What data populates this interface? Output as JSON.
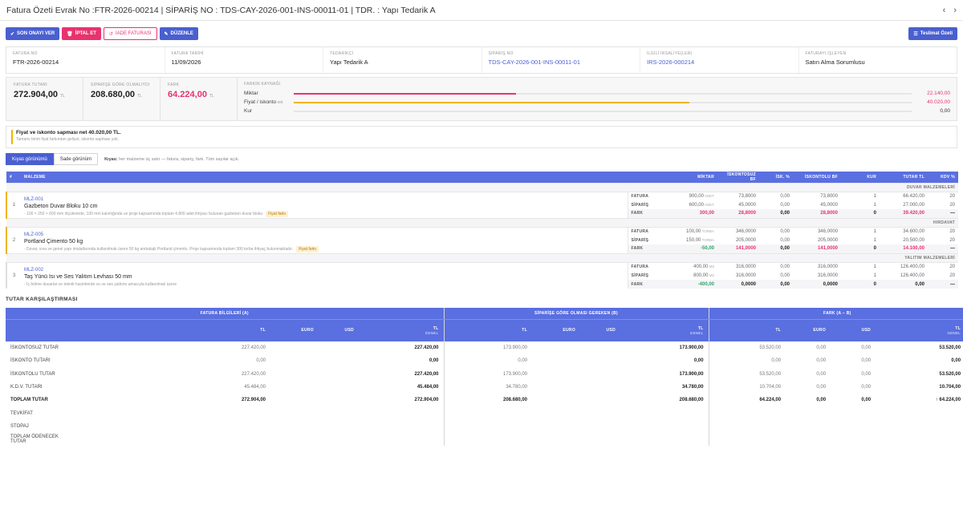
{
  "title": "Fatura Özeti Evrak No :FTR-2026-00214 | SİPARİŞ NO : TDS-CAY-2026-001-INS-00011-01 | TDR. : Yapı Tedarik A",
  "nav": {
    "prev": "‹",
    "next": "›"
  },
  "toolbar": {
    "approve": "SON ONAYI VER",
    "cancel": "İPTAL ET",
    "return_invoice": "İADE FATURASI",
    "edit": "DÜZENLE",
    "delivery_summary": "Teslimat Özeti"
  },
  "info": [
    {
      "label": "FATURA NO",
      "value": "FTR-2026-00214"
    },
    {
      "label": "FATURA TARİHİ",
      "value": "11/09/2026"
    },
    {
      "label": "TEDARİKÇİ",
      "value": "Yapı Tedarik A"
    },
    {
      "label": "SİPARİŞ NO",
      "value": "TDS-CAY-2026-001-INS-00011-01"
    },
    {
      "label": "İLGİLİ İRSALİYE(LER)",
      "value": "IRS-2026-000214"
    },
    {
      "label": "FATURAYI İŞLEYEN",
      "value": "Satın Alma Sorumlusu"
    }
  ],
  "summary": {
    "invoice_total": {
      "label": "FATURA TUTARI",
      "value": "272.904,00",
      "unit": "TL"
    },
    "order_total": {
      "label": "SİPARİŞE GÖRE OLMALIYDI",
      "value": "208.680,00",
      "unit": "TL"
    },
    "diff": {
      "label": "FARK",
      "value": "64.224,00",
      "unit": "TL"
    },
    "source_label": "FARKIN KAYNAĞI",
    "sources": [
      {
        "name": "Miktar",
        "note": "",
        "amount": "22.140,00",
        "ratio": 0.36,
        "color": "#e8336e"
      },
      {
        "name": "Fiyat / iskonto",
        "note": "net",
        "amount": "40.020,00",
        "ratio": 0.64,
        "color": "#f0b400"
      },
      {
        "name": "Kur",
        "note": "",
        "amount": "0,00",
        "ratio": 0,
        "color": "#cccccc"
      }
    ]
  },
  "alert": {
    "title": "Fiyat ve iskonto sapması net 40.020,00 TL.",
    "sub": "Tamamı birim fiyat farkından geliyor, iskonto sapması yok."
  },
  "views": {
    "compare": "Kıyas görünümü",
    "simple": "Sade görünüm",
    "hint_label": "Kıyas:",
    "hint": "her malzeme üç satır — fatura, sipariş, fark. Tüm sayılar açık."
  },
  "material_headers": [
    "#",
    "MALZEME",
    "",
    "MİKTAR",
    "İSKONTOSUZ BF",
    "İSK. %",
    "İSKONTOLU BF",
    "KUR",
    "TUTAR TL",
    "KDV %"
  ],
  "materials": [
    {
      "group": "DUVAR MALZEMELERİ",
      "idx": "1",
      "code": "MLZ-001",
      "name": "Gazbeton Duvar Bloku 10 cm",
      "desc": "· 100 × 250 × 600 mm ölçülerinde, 100 mm kalınlığında ve proje kapsamında toplam 4.800 adet ihtiyacı bulunan gazbeton duvar bloku",
      "tag": "Fiyat farkı",
      "rows": [
        {
          "label": "FATURA",
          "qty": "900,00",
          "unit": "ADET",
          "gross": "73,8000",
          "disc": "0,00",
          "net": "73,8000",
          "rate": "1",
          "total": "66.420,00",
          "vat": "20"
        },
        {
          "label": "SİPARİŞ",
          "qty": "600,00",
          "unit": "ADET",
          "gross": "45,0000",
          "disc": "0,00",
          "net": "45,0000",
          "rate": "1",
          "total": "27.000,00",
          "vat": "20"
        },
        {
          "label": "FARK",
          "qty": "300,00",
          "unit": "",
          "gross": "28,8000",
          "disc": "0,00",
          "net": "28,8000",
          "rate": "0",
          "total": "39.420,00",
          "vat": "—"
        }
      ]
    },
    {
      "group": "HIRDAVAT",
      "idx": "2",
      "code": "MLZ-005",
      "name": "Portland Çimento 50 kg",
      "desc": "· Duvar, sıva ve genel yapı imalatlarında kullanılmak üzere 50 kg ambalajlı Portland çimento. Proje kapsamında toplam 300 torba ihtiyaç bulunmaktadır.",
      "tag": "Fiyat farkı",
      "rows": [
        {
          "label": "FATURA",
          "qty": "100,00",
          "unit": "TORBA",
          "gross": "346,0000",
          "disc": "0,00",
          "net": "346,0000",
          "rate": "1",
          "total": "34.600,00",
          "vat": "20"
        },
        {
          "label": "SİPARİŞ",
          "qty": "150,00",
          "unit": "TORBA",
          "gross": "205,0000",
          "disc": "0,00",
          "net": "205,0000",
          "rate": "1",
          "total": "20.500,00",
          "vat": "20"
        },
        {
          "label": "FARK",
          "qty": "-50,00",
          "unit": "",
          "gross": "141,0000",
          "disc": "0,00",
          "net": "141,0000",
          "rate": "0",
          "total": "14.100,00",
          "vat": "—"
        }
      ]
    },
    {
      "group": "YALITIM MALZEMELERİ",
      "idx": "3",
      "code": "MLZ-002",
      "name": "Taş Yünü Isı ve Ses Yalıtım Levhası 50 mm",
      "desc": "· İç bölme duvarlar ve teknik hacimlerde ısı ve ses yalıtımı amacıyla kullanılmak üzere",
      "tag": "",
      "rows": [
        {
          "label": "FATURA",
          "qty": "400,00",
          "unit": "M2",
          "gross": "316,0000",
          "disc": "0,00",
          "net": "316,0000",
          "rate": "1",
          "total": "126.400,00",
          "vat": "20"
        },
        {
          "label": "SİPARİŞ",
          "qty": "800,00",
          "unit": "M2",
          "gross": "316,0000",
          "disc": "0,00",
          "net": "316,0000",
          "rate": "1",
          "total": "126.400,00",
          "vat": "20"
        },
        {
          "label": "FARK",
          "qty": "-400,00",
          "unit": "",
          "gross": "0,0000",
          "disc": "0,00",
          "net": "0,0000",
          "rate": "0",
          "total": "0,00",
          "vat": "—"
        }
      ]
    }
  ],
  "comparison": {
    "title": "TUTAR KARŞILAŞTIRMASI",
    "groups": [
      "FATURA BİLGİLERİ (A)",
      "SİPARİŞE GÖRE OLMASI GEREKEN (B)",
      "FARK (A − B)"
    ],
    "headers": [
      "",
      "TL",
      "EURO",
      "USD",
      "TL",
      "TL",
      "EURO",
      "USD",
      "TL",
      "TL",
      "EURO",
      "USD",
      "TL"
    ],
    "header_sub": {
      "4": "GENEL",
      "8": "GENEL",
      "12": "GENEL"
    },
    "rows": [
      {
        "label": "İSKONTOSUZ TUTAR",
        "cells": [
          "227.420,00",
          "",
          "",
          "227.420,00",
          "173.900,00",
          "",
          "",
          "173.900,00",
          "53.520,00",
          "0,00",
          "0,00",
          "53.520,00"
        ]
      },
      {
        "label": "İSKONTO TUTARI",
        "cells": [
          "0,00",
          "",
          "",
          "0,00",
          "0,00",
          "",
          "",
          "0,00",
          "0,00",
          "0,00",
          "0,00",
          "0,00"
        ]
      },
      {
        "label": "İSKONTOLU TUTAR",
        "cells": [
          "227.420,00",
          "",
          "",
          "227.420,00",
          "173.900,00",
          "",
          "",
          "173.900,00",
          "53.520,00",
          "0,00",
          "0,00",
          "53.520,00"
        ]
      },
      {
        "label": "K.D.V. TUTARI",
        "cells": [
          "45.484,00",
          "",
          "",
          "45.484,00",
          "34.780,00",
          "",
          "",
          "34.780,00",
          "10.704,00",
          "0,00",
          "0,00",
          "10.704,00"
        ]
      },
      {
        "label": "TOPLAM TUTAR",
        "cells": [
          "272.904,00",
          "",
          "",
          "272.904,00",
          "208.680,00",
          "",
          "",
          "208.680,00",
          "64.224,00",
          "0,00",
          "0,00",
          "↑ 64.224,00"
        ],
        "total": true
      },
      {
        "label": "TEVKİFAT",
        "cells": [
          "",
          "",
          "",
          "",
          "",
          "",
          "",
          "",
          "",
          "",
          "",
          ""
        ]
      },
      {
        "label": "STOPAJ",
        "cells": [
          "",
          "",
          "",
          "",
          "",
          "",
          "",
          "",
          "",
          "",
          "",
          ""
        ]
      },
      {
        "label": "TOPLAM ÖDENECEK TUTAR",
        "cells": [
          "",
          "",
          "",
          "",
          "",
          "",
          "",
          "",
          "",
          "",
          "",
          ""
        ]
      }
    ]
  }
}
